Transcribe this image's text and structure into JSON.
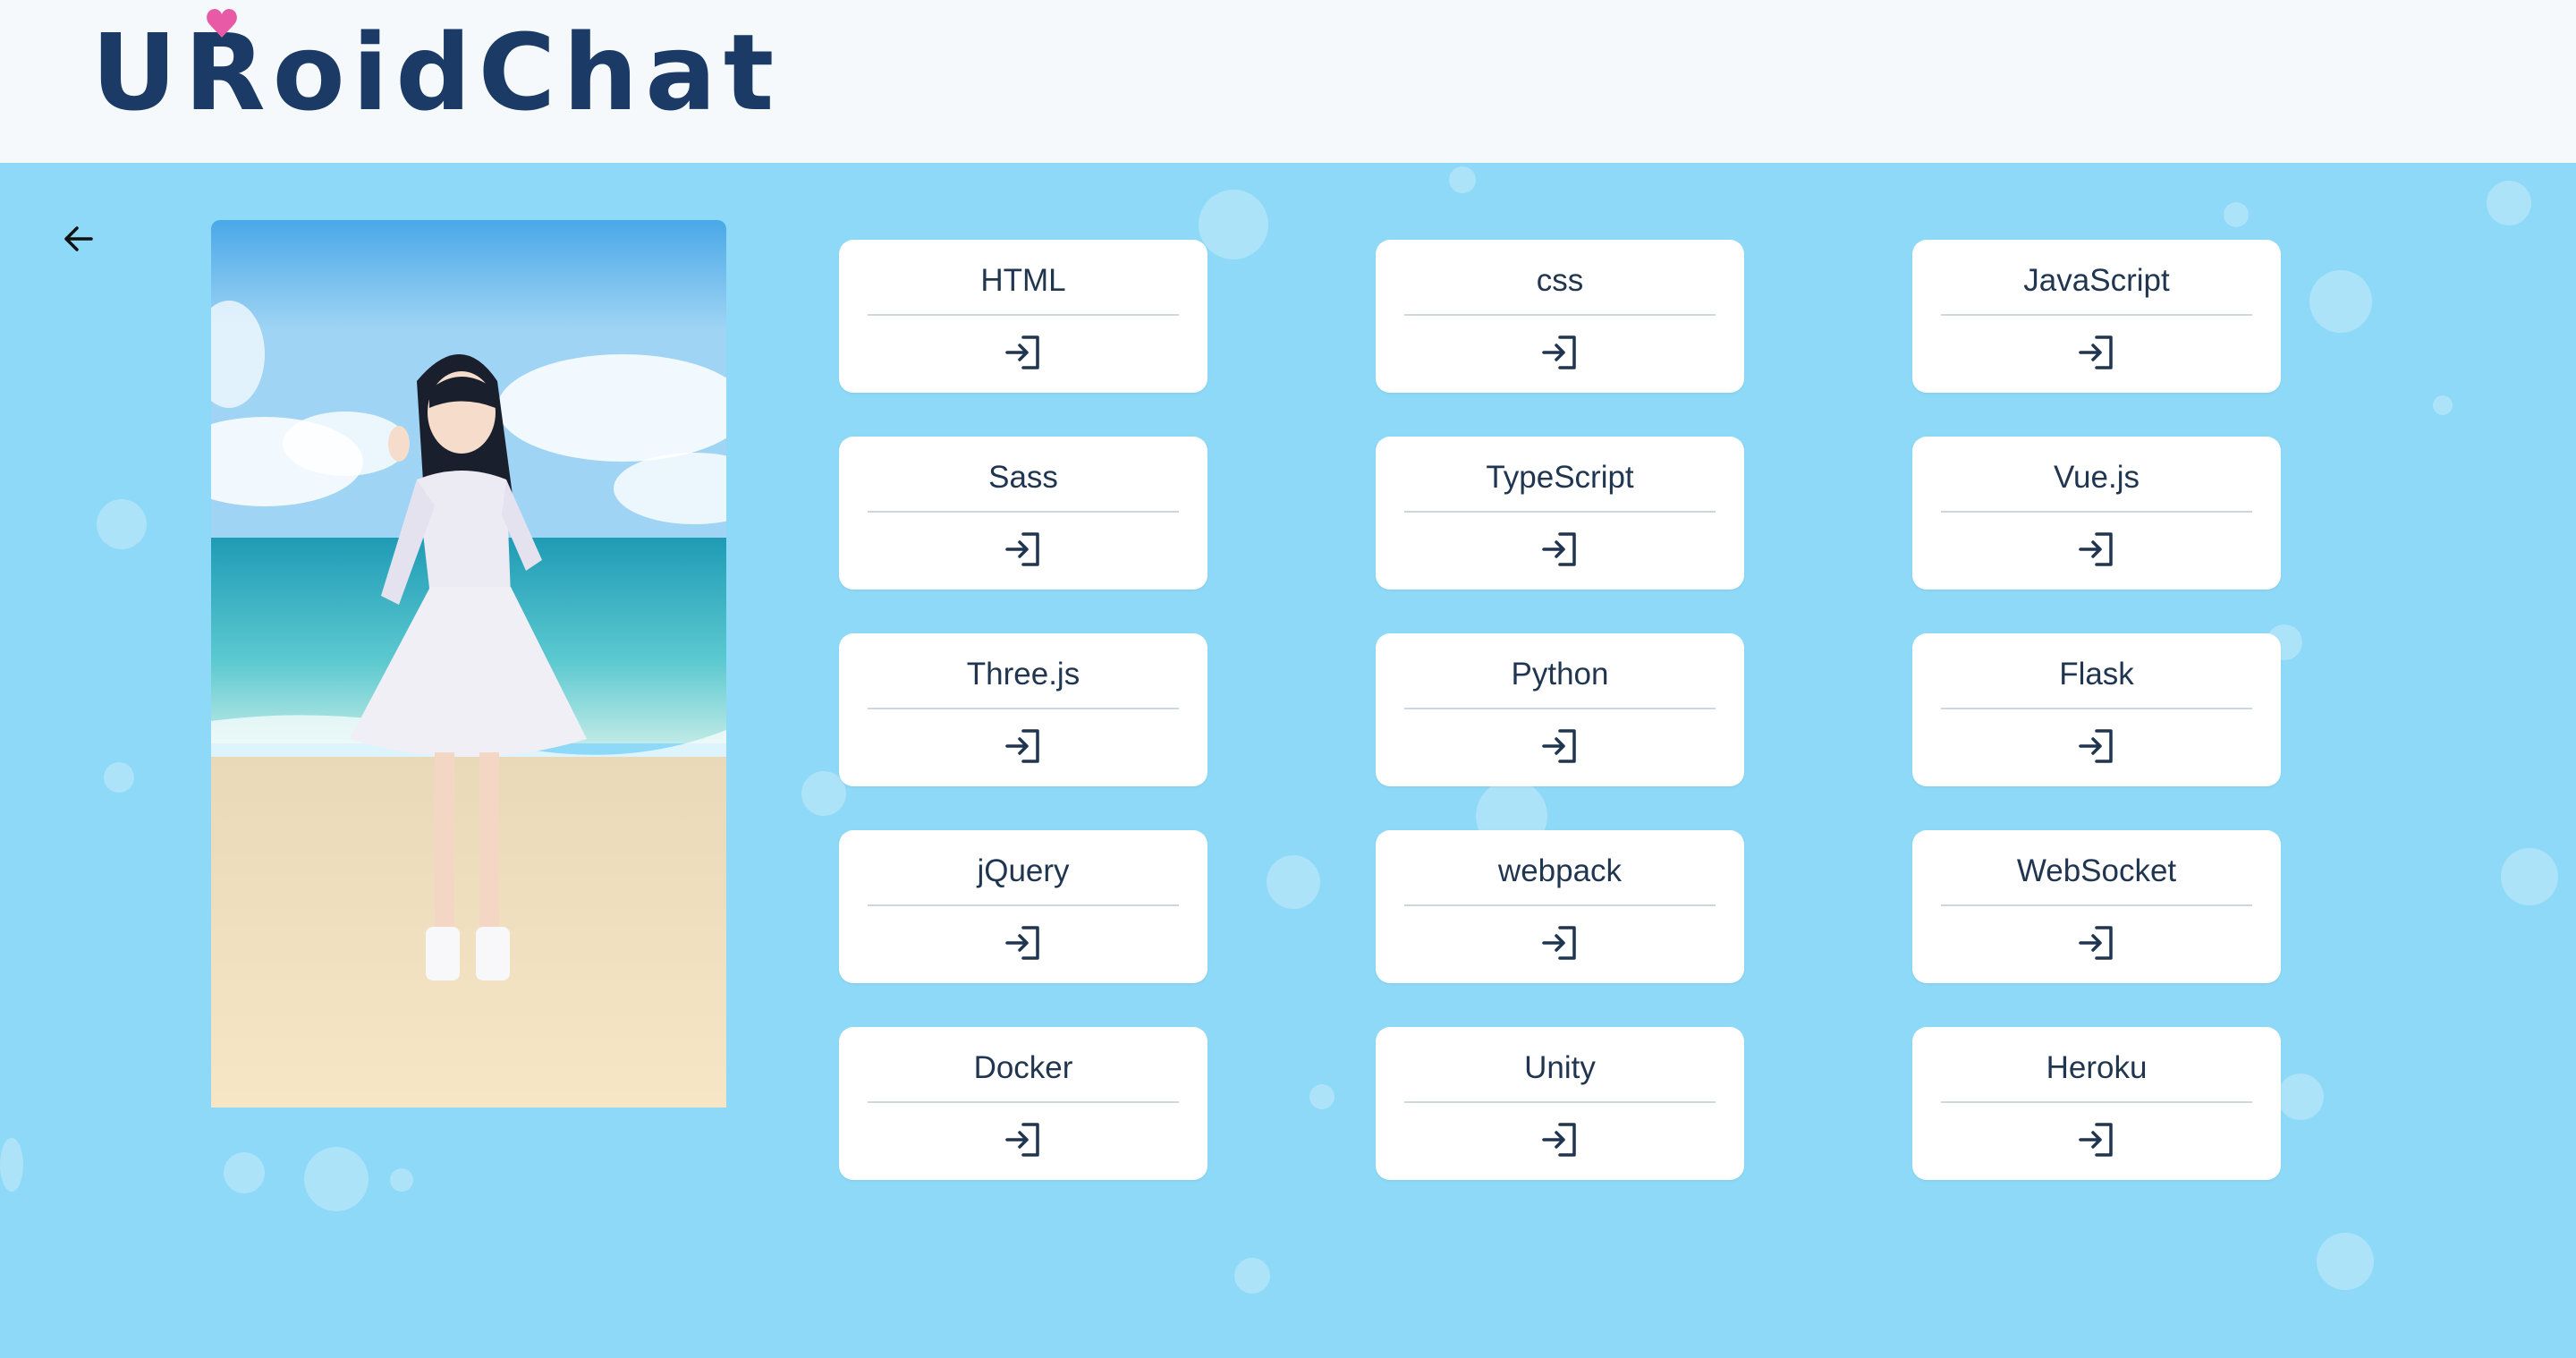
{
  "header": {
    "logo_text": "URoidChat",
    "logo_heart_color": "#e85aa6",
    "brand_color": "#1b3a66"
  },
  "main": {
    "background_color": "#8dd9f7",
    "back_icon": "arrow-left-icon",
    "avatar_image": "character-on-beach-illustration"
  },
  "rooms": [
    {
      "label": "HTML",
      "icon": "enter-icon"
    },
    {
      "label": "css",
      "icon": "enter-icon"
    },
    {
      "label": "JavaScript",
      "icon": "enter-icon"
    },
    {
      "label": "Sass",
      "icon": "enter-icon"
    },
    {
      "label": "TypeScript",
      "icon": "enter-icon"
    },
    {
      "label": "Vue.js",
      "icon": "enter-icon"
    },
    {
      "label": "Three.js",
      "icon": "enter-icon"
    },
    {
      "label": "Python",
      "icon": "enter-icon"
    },
    {
      "label": "Flask",
      "icon": "enter-icon"
    },
    {
      "label": "jQuery",
      "icon": "enter-icon"
    },
    {
      "label": "webpack",
      "icon": "enter-icon"
    },
    {
      "label": "WebSocket",
      "icon": "enter-icon"
    },
    {
      "label": "Docker",
      "icon": "enter-icon"
    },
    {
      "label": "Unity",
      "icon": "enter-icon"
    },
    {
      "label": "Heroku",
      "icon": "enter-icon"
    }
  ]
}
